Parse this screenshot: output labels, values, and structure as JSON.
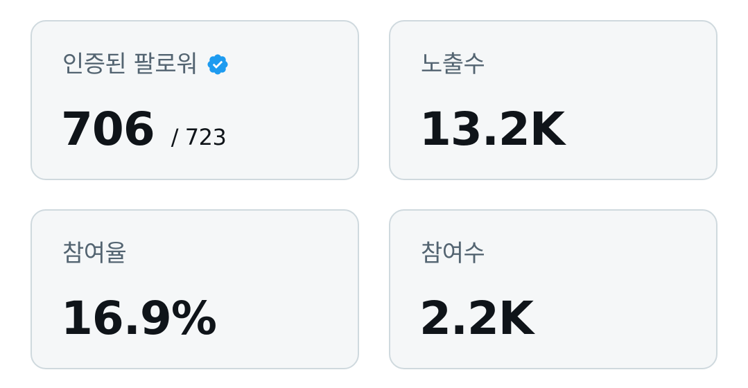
{
  "stats": {
    "verified_followers": {
      "label": "인증된 팔로워",
      "icon": "verified-badge-icon",
      "value": "706",
      "total": "/ 723"
    },
    "impressions": {
      "label": "노출수",
      "value": "13.2K"
    },
    "engagement_rate": {
      "label": "참여율",
      "value": "16.9%"
    },
    "engagements": {
      "label": "참여수",
      "value": "2.2K"
    }
  },
  "colors": {
    "card_bg": "#f5f7f8",
    "card_border": "#cfd9de",
    "label": "#536471",
    "value": "#0f1419",
    "verified": "#1d9bf0"
  }
}
